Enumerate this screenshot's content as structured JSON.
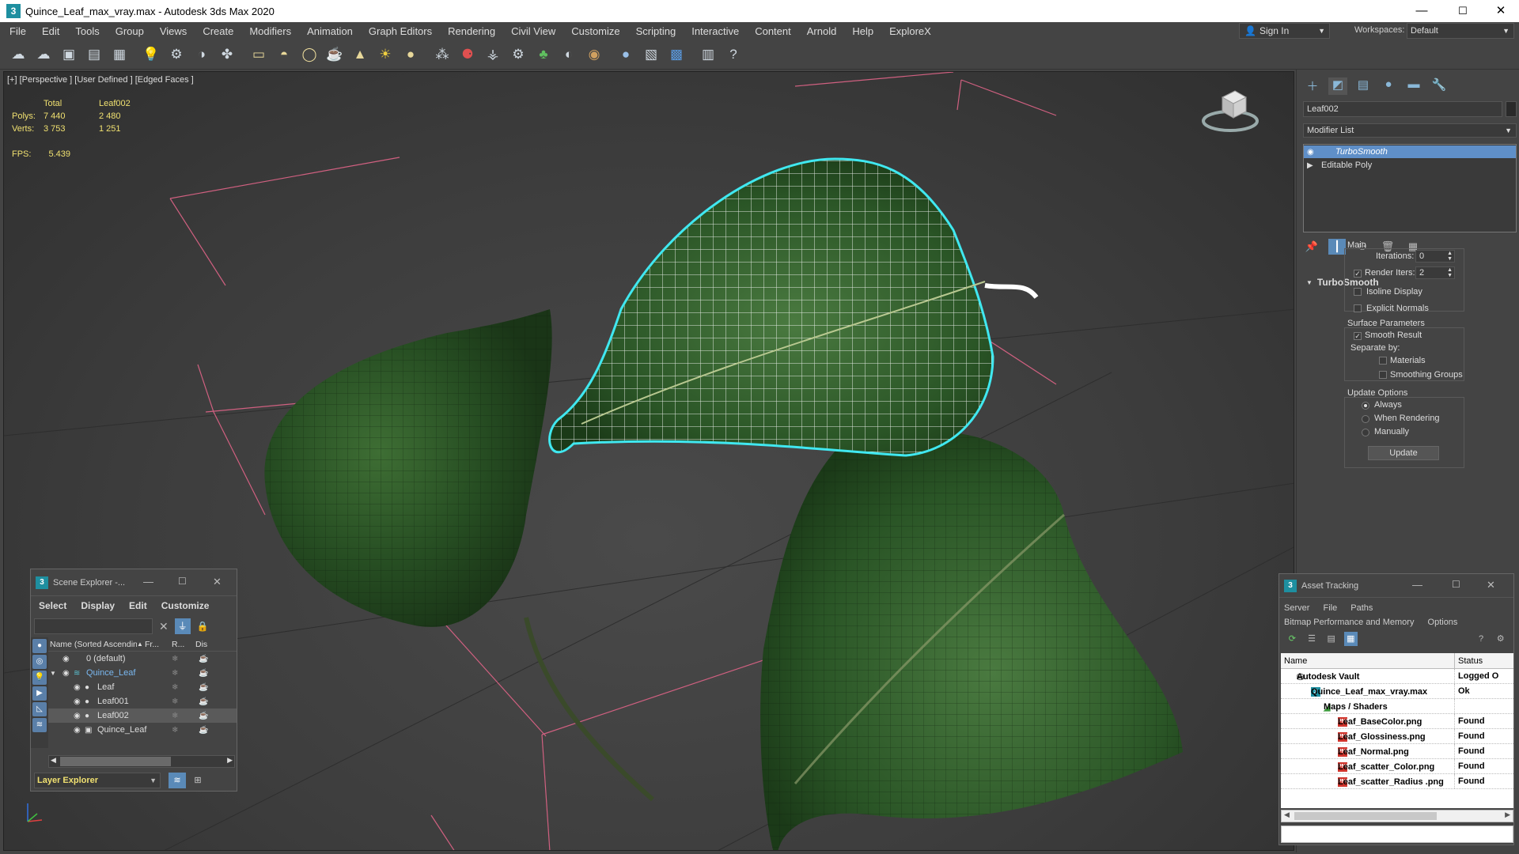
{
  "window": {
    "title": "Quince_Leaf_max_vray.max - Autodesk 3ds Max 2020",
    "minimize": "—",
    "maximize": "☐",
    "close": "✕"
  },
  "menu": [
    "File",
    "Edit",
    "Tools",
    "Group",
    "Views",
    "Create",
    "Modifiers",
    "Animation",
    "Graph Editors",
    "Rendering",
    "Civil View",
    "Customize",
    "Scripting",
    "Interactive",
    "Content",
    "Arnold",
    "Help",
    "ExploreX"
  ],
  "signin": {
    "label": "Sign In"
  },
  "workspaces": {
    "label": "Workspaces:",
    "value": "Default"
  },
  "toolbar_icons": [
    "undo-icon",
    "redo-icon",
    "render-setup-icon",
    "material-editor-icon",
    "layer-manager-icon",
    "light-lister-icon",
    "link-icon",
    "unlink-icon",
    "bind-icon",
    "box-icon",
    "hemisphere-icon",
    "sphere-icon",
    "teapot-icon",
    "cone-icon",
    "sun-icon",
    "ball-icon",
    "particle-icon",
    "physics-icon",
    "hair-icon",
    "gear-icon",
    "grass-icon",
    "hdr-icon",
    "texture-icon",
    "shader-ball-icon",
    "render-icon",
    "frame-buffer-icon",
    "export-icon",
    "help-icon"
  ],
  "viewport": {
    "label": "[+] [Perspective ] [User Defined ] [Edged Faces ]",
    "stats": {
      "header_total": "Total",
      "header_object": "Leaf002",
      "polys_label": "Polys:",
      "polys_total": "7 440",
      "polys_object": "2 480",
      "verts_label": "Verts:",
      "verts_total": "3 753",
      "verts_object": "1 251"
    },
    "fps_label": "FPS:",
    "fps_value": "5.439"
  },
  "scene_explorer": {
    "title": "Scene Explorer -...",
    "menu": [
      "Select",
      "Display",
      "Edit",
      "Customize"
    ],
    "columns": {
      "name": "Name (Sorted Ascending)",
      "sort": "▲",
      "frozen": "Fr...",
      "render": "R...",
      "display": "Dis"
    },
    "rows": [
      {
        "name": "0 (default)",
        "indent": 0
      },
      {
        "name": "Quince_Leaf",
        "indent": 0
      },
      {
        "name": "Leaf",
        "indent": 1
      },
      {
        "name": "Leaf001",
        "indent": 1
      },
      {
        "name": "Leaf002",
        "indent": 1
      },
      {
        "name": "Quince_Leaf",
        "indent": 1
      }
    ],
    "footer": "Layer Explorer"
  },
  "command_panel": {
    "object_name": "Leaf002",
    "modifier_list": "Modifier List",
    "stack": [
      "TurboSmooth",
      "Editable Poly"
    ],
    "rollout": {
      "title": "TurboSmooth",
      "main": "Main",
      "iterations_label": "Iterations:",
      "iterations_value": "0",
      "render_iters_label": "Render Iters:",
      "render_iters_value": "2",
      "isoline": "Isoline Display",
      "explicit_normals": "Explicit Normals",
      "surface_params": "Surface Parameters",
      "smooth_result": "Smooth Result",
      "separate_by": "Separate by:",
      "materials": "Materials",
      "smoothing_groups": "Smoothing Groups",
      "update_options": "Update Options",
      "always": "Always",
      "when_rendering": "When Rendering",
      "manually": "Manually",
      "update_button": "Update"
    }
  },
  "asset_tracking": {
    "title": "Asset Tracking",
    "menu_row1": [
      "Server",
      "File",
      "Paths"
    ],
    "menu_row2": [
      "Bitmap Performance and Memory",
      "Options"
    ],
    "columns": {
      "name": "Name",
      "status": "Status"
    },
    "rows": [
      {
        "name": "Autodesk Vault",
        "status": "Logged O",
        "indent": 1,
        "type": "vault"
      },
      {
        "name": "Quince_Leaf_max_vray.max",
        "status": "Ok",
        "indent": 2,
        "type": "max"
      },
      {
        "name": "Maps / Shaders",
        "status": "",
        "indent": 3,
        "type": "maps"
      },
      {
        "name": "Leaf_BaseColor.png",
        "status": "Found",
        "indent": 4,
        "type": "png"
      },
      {
        "name": "Leaf_Glossiness.png",
        "status": "Found",
        "indent": 4,
        "type": "png"
      },
      {
        "name": "Leaf_Normal.png",
        "status": "Found",
        "indent": 4,
        "type": "png"
      },
      {
        "name": "Leaf_scatter_Color.png",
        "status": "Found",
        "indent": 4,
        "type": "png"
      },
      {
        "name": "Leaf_scatter_Radius .png",
        "status": "Found",
        "indent": 4,
        "type": "png"
      }
    ]
  }
}
